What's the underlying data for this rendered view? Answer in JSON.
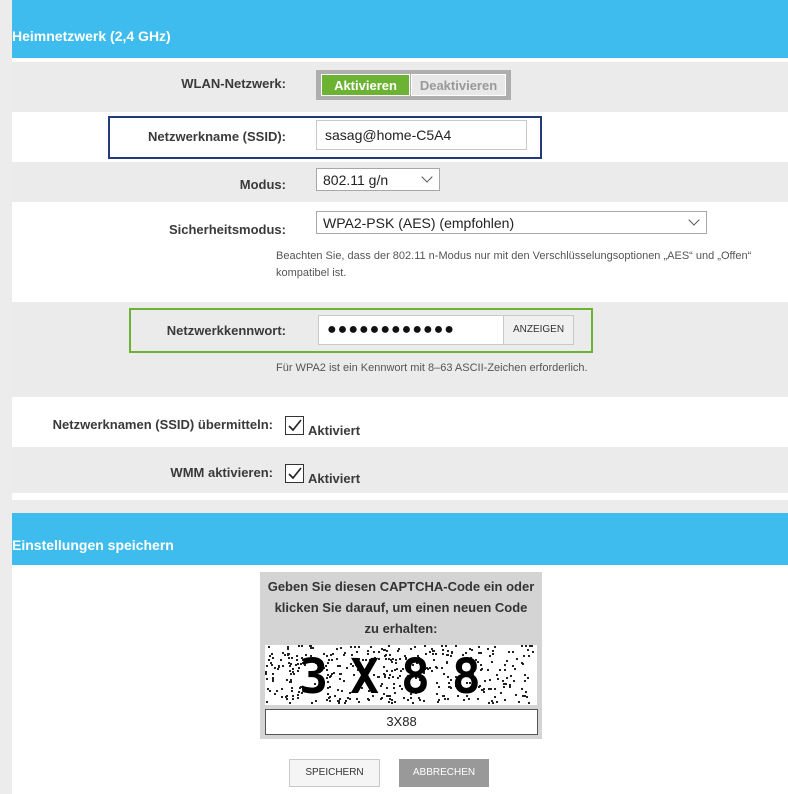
{
  "wifi": {
    "section_title": "Heimnetzwerk (2,4 GHz)",
    "network_label": "WLAN-Netzwerk:",
    "activate_label": "Aktivieren",
    "deactivate_label": "Deaktivieren",
    "ssid_label": "Netzwerkname (SSID):",
    "ssid_value": "sasag@home-C5A4",
    "mode_label": "Modus:",
    "mode_value": "802.11 g/n",
    "security_label": "Sicherheitsmodus:",
    "security_value": "WPA2-PSK (AES) (empfohlen)",
    "security_note": "Beachten Sie, dass der 802.11 n-Modus nur mit den Verschlüsselungsoptionen „AES“ und „Offen“ kompatibel ist.",
    "password_label": "Netzwerkkennwort:",
    "password_value": "●●●●●●●●●●●●",
    "show_label": "ANZEIGEN",
    "password_note": "Für WPA2 ist ein Kennwort mit 8–63 ASCII-Zeichen erforderlich.",
    "broadcast_label": "Netzwerknamen (SSID) übermitteln:",
    "broadcast_value": "Aktiviert",
    "broadcast_checked": true,
    "wmm_label": "WMM aktivieren:",
    "wmm_value": "Aktiviert",
    "wmm_checked": true
  },
  "save": {
    "section_title": "Einstellungen speichern",
    "captcha_prompt": "Geben Sie diesen CAPTCHA-Code ein oder klicken Sie darauf, um einen neuen Code zu erhalten:",
    "captcha_image_text": "3X88",
    "captcha_value": "3X88",
    "save_label": "SPEICHERN",
    "cancel_label": "ABBRECHEN"
  },
  "colors": {
    "header": "#3ebced",
    "active_green": "#6cb333",
    "ssid_frame": "#233a7a",
    "password_frame": "#6cb333"
  }
}
